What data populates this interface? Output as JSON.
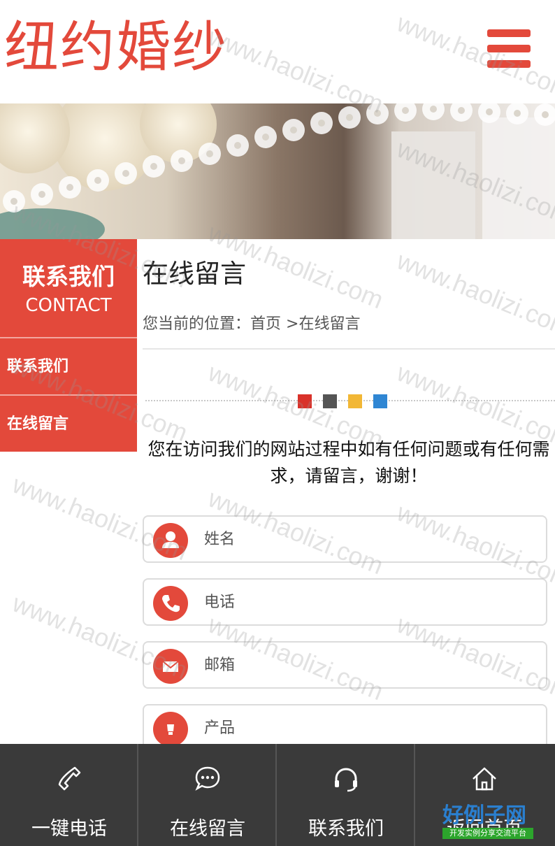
{
  "header": {
    "logo_text": "纽约婚纱",
    "menu_icon": "hamburger-menu-icon",
    "accent_color": "#e3493b"
  },
  "sidebar": {
    "title": "联系我们",
    "subtitle": "CONTACT",
    "items": [
      {
        "label": "联系我们"
      },
      {
        "label": "在线留言"
      }
    ]
  },
  "main": {
    "title": "在线留言",
    "breadcrumb": {
      "prefix": "您当前的位置：",
      "home": "首页",
      "separator": " >",
      "current": "在线留言"
    },
    "divider_colors": [
      "#d9322a",
      "#555555",
      "#f2b735",
      "#2f86d3"
    ],
    "intro": "您在访问我们的网站过程中如有任何问题或有任何需求，请留言，谢谢！",
    "form": {
      "fields": [
        {
          "placeholder": "姓名",
          "icon": "person-icon"
        },
        {
          "placeholder": "电话",
          "icon": "phone-icon"
        },
        {
          "placeholder": "邮箱",
          "icon": "mail-icon"
        },
        {
          "placeholder": "产品",
          "icon": "product-icon"
        }
      ]
    }
  },
  "bottom_bar": {
    "items": [
      {
        "label": "一键电话",
        "icon": "phone-handset-icon"
      },
      {
        "label": "在线留言",
        "icon": "chat-bubble-icon"
      },
      {
        "label": "联系我们",
        "icon": "headset-icon"
      },
      {
        "label": "返回首页",
        "icon": "home-icon"
      }
    ]
  },
  "watermark": {
    "text": "www.haolizi.com"
  },
  "corner_logo": {
    "title": "好例子网",
    "tagline": "开发实例分享交流平台"
  }
}
